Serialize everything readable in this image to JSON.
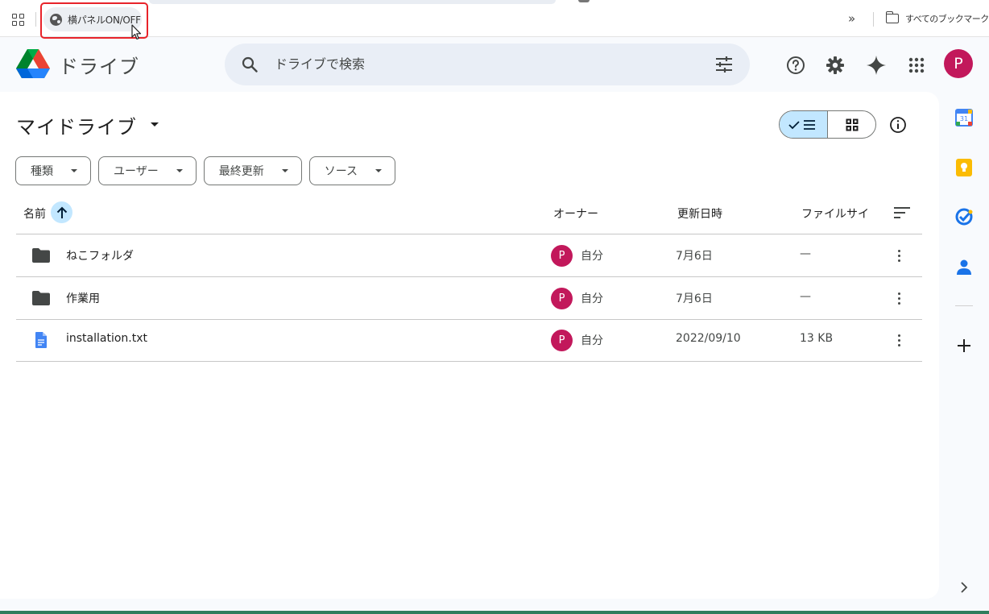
{
  "browser": {
    "bookmarks": {
      "panel_toggle_label": "横パネルON/OFF",
      "overflow_label": "»",
      "all_bookmarks_label": "すべてのブックマーク"
    }
  },
  "header": {
    "app_title": "ドライブ",
    "search_placeholder": "ドライブで検索",
    "account_initial": "P",
    "icons": [
      "drive-logo",
      "search-icon",
      "tune-icon",
      "help-icon",
      "gear-icon",
      "gemini-sparkle-icon",
      "apps-grid-icon"
    ]
  },
  "main": {
    "title": "マイドライブ",
    "filters": [
      {
        "label": "種類"
      },
      {
        "label": "ユーザー"
      },
      {
        "label": "最終更新"
      },
      {
        "label": "ソース"
      }
    ],
    "columns": {
      "name": "名前",
      "owner": "オーナー",
      "modified": "更新日時",
      "size": "ファイルサイ"
    },
    "rows": [
      {
        "type": "folder",
        "name": "ねこフォルダ",
        "owner_initial": "P",
        "owner": "自分",
        "modified": "7月6日",
        "size": "—"
      },
      {
        "type": "folder",
        "name": "作業用",
        "owner_initial": "P",
        "owner": "自分",
        "modified": "7月6日",
        "size": "—"
      },
      {
        "type": "doc",
        "name": "installation.txt",
        "owner_initial": "P",
        "owner": "自分",
        "modified": "2022/09/10",
        "size": "13 KB"
      }
    ]
  },
  "side_panel": {
    "calendar_day": "31",
    "apps": [
      "calendar-icon",
      "keep-icon",
      "tasks-icon",
      "contacts-icon"
    ]
  },
  "colors": {
    "avatar": "#c2185b",
    "accent_light": "#c2e7ff",
    "highlight": "#e8232a"
  }
}
